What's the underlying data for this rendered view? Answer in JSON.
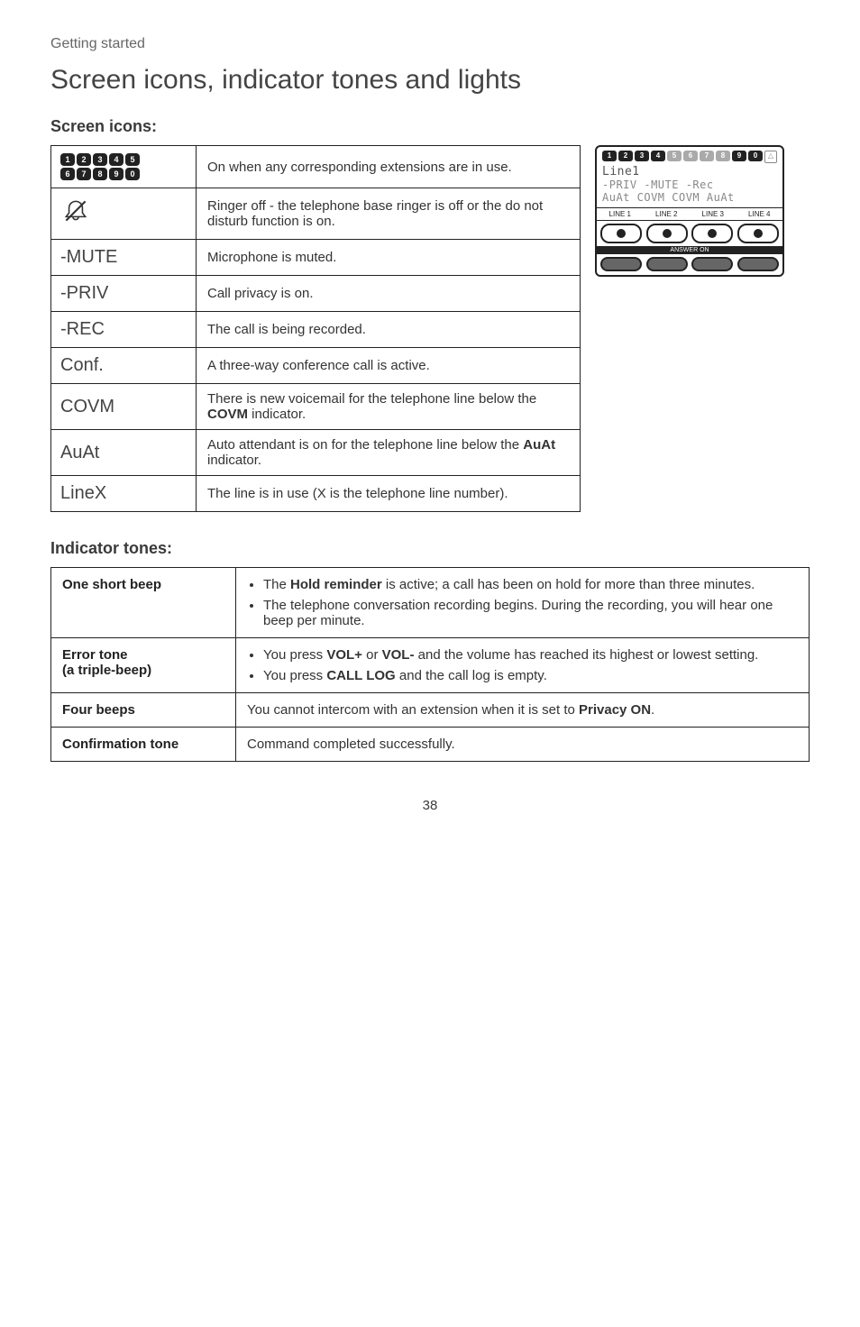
{
  "topLabel": "Getting started",
  "title": "Screen icons, indicator tones and lights",
  "screenIconsHeading": "Screen icons:",
  "iconsTable": [
    {
      "key": "__ext__",
      "desc": "On when any corresponding extensions are in use."
    },
    {
      "key": "__bell__",
      "desc": "Ringer off - the telephone base ringer is off or the do not disturb function is on."
    },
    {
      "key": "-MUTE",
      "desc": "Microphone is muted."
    },
    {
      "key": "-PRIV",
      "desc": "Call privacy is on."
    },
    {
      "key": "-REC",
      "desc": "The call is being recorded."
    },
    {
      "key": "Conf.",
      "desc": "A three-way conference call is active."
    },
    {
      "key": "COVM",
      "desc_html": "There is new voicemail for the telephone line below the <b>COVM</b> indicator."
    },
    {
      "key": "AuAt",
      "desc_html": "Auto attendant is on for the telephone line below the <b>AuAt</b> indicator."
    },
    {
      "key": "LineX",
      "desc": "The line is in use (X is the telephone line number)."
    }
  ],
  "lcd": {
    "pills": [
      "1",
      "2",
      "3",
      "4",
      "5",
      "6",
      "7",
      "8",
      "9",
      "0"
    ],
    "line1": "Line1",
    "flags1": "-PRIV  -MUTE  -Rec",
    "flags2": "AuAt COVM COVM AuAt",
    "lines": [
      "LINE 1",
      "LINE 2",
      "LINE 3",
      "LINE 4"
    ],
    "answer": "ANSWER ON"
  },
  "tonesHeading": "Indicator tones:",
  "tones": [
    {
      "name": "One short beep",
      "items_html": [
        "The <b>Hold reminder</b> is active; a call has been on hold for more than three minutes.",
        "The telephone conversation recording begins. During the recording, you will hear one beep per minute."
      ]
    },
    {
      "name": "Error tone\n(a triple-beep)",
      "items_html": [
        "You press <b>VOL+</b> or <b>VOL-</b> and the volume has reached its highest or lowest setting.",
        "You press <b>CALL LOG</b> and the call log is empty."
      ]
    },
    {
      "name": "Four beeps",
      "plain_html": "You cannot intercom with an extension when it is set to <b>Privacy ON</b>."
    },
    {
      "name": "Confirmation tone",
      "plain_html": "Command completed successfully."
    }
  ],
  "pageNumber": "38"
}
